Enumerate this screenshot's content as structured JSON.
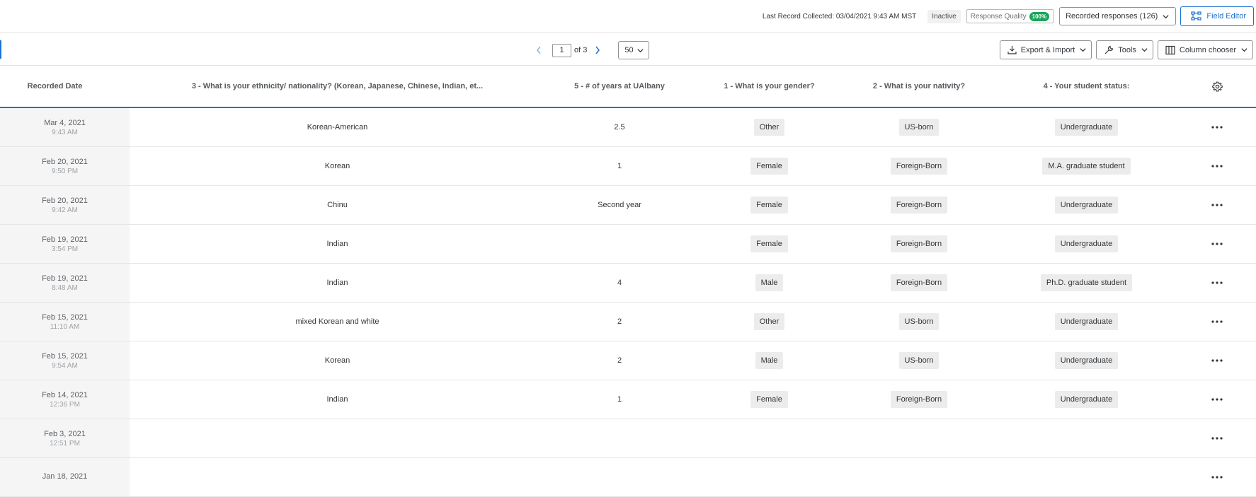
{
  "header": {
    "last_record": "Last Record Collected: 03/04/2021 9:43 AM MST",
    "status": "Inactive",
    "response_quality_label": "Response Quality",
    "response_quality_value": "100%",
    "recorded_responses": "Recorded responses (126)",
    "field_editor": "Field Editor"
  },
  "pager": {
    "current_page": "1",
    "of_label": "of 3",
    "per_page": "50"
  },
  "tools": {
    "export_import": "Export & Import",
    "tools": "Tools",
    "column_chooser": "Column chooser"
  },
  "columns": {
    "recorded_date": "Recorded Date",
    "ethnicity": "3 - What is your ethnicity/ nationality? (Korean, Japanese, Chinese, Indian, et...",
    "years": "5 - # of years at UAlbany",
    "gender": "1 - What is your gender?",
    "nativity": "2 - What is your nativity?",
    "student_status": "4 - Your student status:"
  },
  "rows": [
    {
      "date": "Mar 4, 2021",
      "time": "9:43 AM",
      "ethnicity": "Korean-American",
      "years": "2.5",
      "gender": "Other",
      "nativity": "US-born",
      "status": "Undergraduate"
    },
    {
      "date": "Feb 20, 2021",
      "time": "9:50 PM",
      "ethnicity": "Korean",
      "years": "1",
      "gender": "Female",
      "nativity": "Foreign-Born",
      "status": "M.A. graduate student"
    },
    {
      "date": "Feb 20, 2021",
      "time": "9:42 AM",
      "ethnicity": "Chinu",
      "years": "Second year",
      "gender": "Female",
      "nativity": "Foreign-Born",
      "status": "Undergraduate"
    },
    {
      "date": "Feb 19, 2021",
      "time": "3:54 PM",
      "ethnicity": "Indian",
      "years": "",
      "gender": "Female",
      "nativity": "Foreign-Born",
      "status": "Undergraduate"
    },
    {
      "date": "Feb 19, 2021",
      "time": "8:48 AM",
      "ethnicity": "Indian",
      "years": "4",
      "gender": "Male",
      "nativity": "Foreign-Born",
      "status": "Ph.D. graduate student"
    },
    {
      "date": "Feb 15, 2021",
      "time": "11:10 AM",
      "ethnicity": "mixed Korean and white",
      "years": "2",
      "gender": "Other",
      "nativity": "US-born",
      "status": "Undergraduate"
    },
    {
      "date": "Feb 15, 2021",
      "time": "9:54 AM",
      "ethnicity": "Korean",
      "years": "2",
      "gender": "Male",
      "nativity": "US-born",
      "status": "Undergraduate"
    },
    {
      "date": "Feb 14, 2021",
      "time": "12:36 PM",
      "ethnicity": "Indian",
      "years": "1",
      "gender": "Female",
      "nativity": "Foreign-Born",
      "status": "Undergraduate"
    },
    {
      "date": "Feb 3, 2021",
      "time": "12:51 PM",
      "ethnicity": "",
      "years": "",
      "gender": "",
      "nativity": "",
      "status": ""
    },
    {
      "date": "Jan 18, 2021",
      "time": "",
      "ethnicity": "",
      "years": "",
      "gender": "",
      "nativity": "",
      "status": ""
    }
  ]
}
